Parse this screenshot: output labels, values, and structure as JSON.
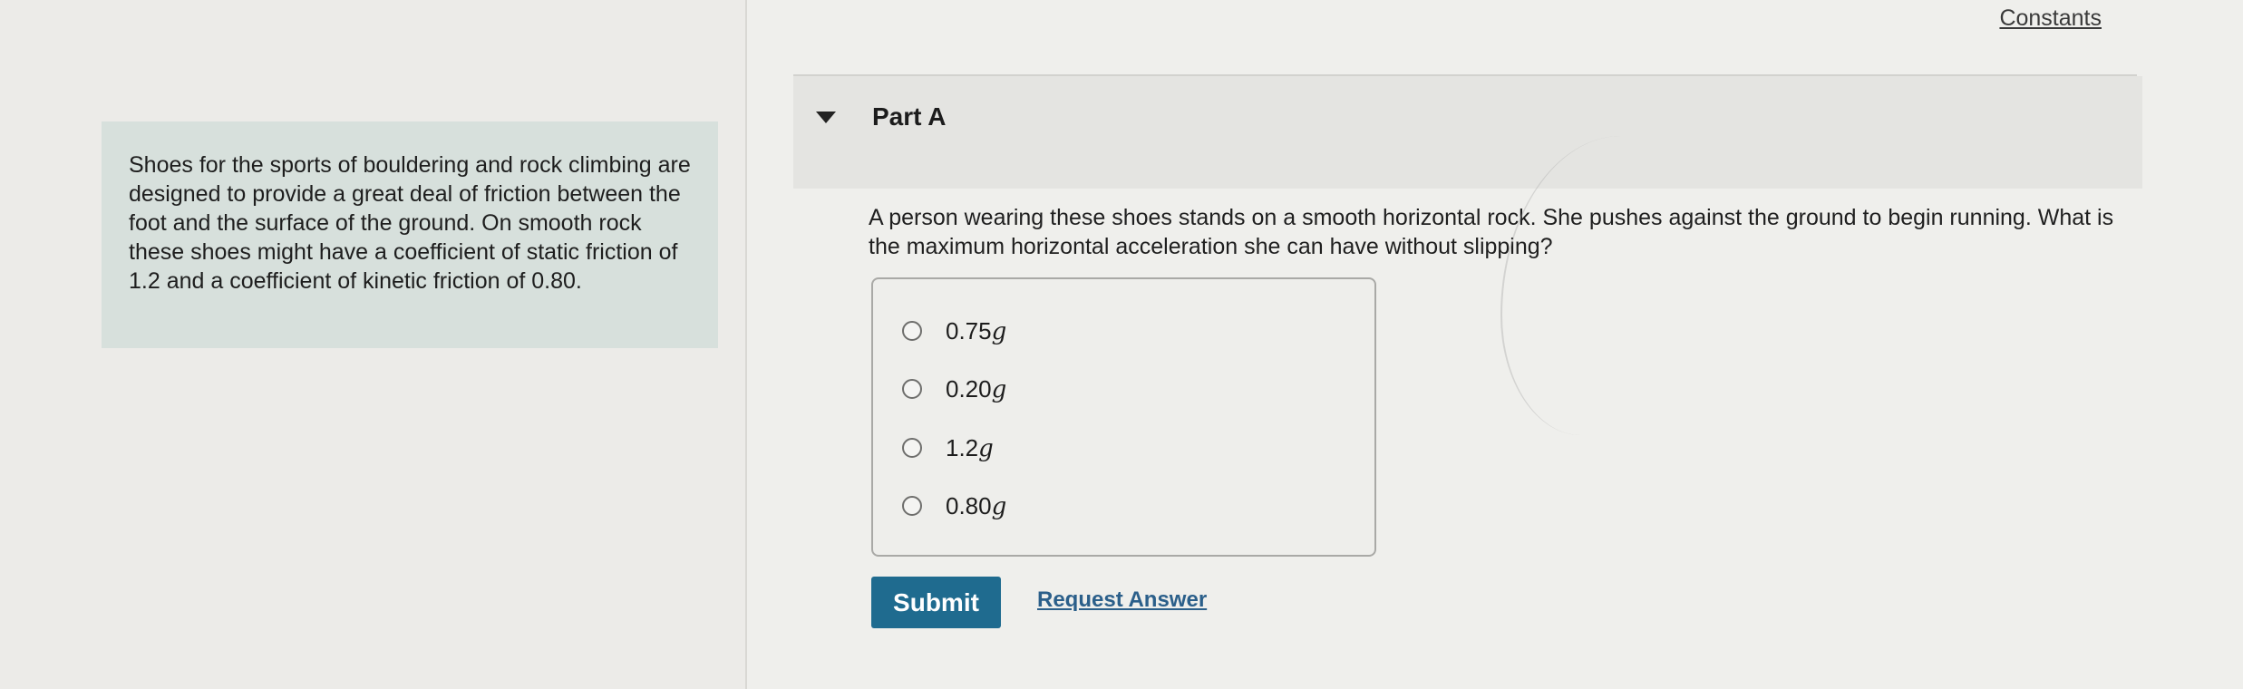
{
  "header": {
    "constants_link": "Constants"
  },
  "intro": {
    "text": "Shoes for the sports of bouldering and rock climbing are designed to provide a great deal of friction between the foot and the surface of the ground. On smooth rock these shoes might have a coefficient of static friction of 1.2 and a coefficient of kinetic friction of 0.80."
  },
  "part": {
    "title": "Part A",
    "question": "A person wearing these shoes stands on a smooth horizontal rock. She pushes against the ground to begin running. What is the maximum horizontal acceleration she can have without slipping?",
    "options": [
      {
        "value": "0.75",
        "unit": "g"
      },
      {
        "value": "0.20",
        "unit": "g"
      },
      {
        "value": "1.2",
        "unit": "g"
      },
      {
        "value": "0.80",
        "unit": "g"
      }
    ],
    "submit_label": "Submit",
    "request_answer_label": "Request Answer"
  }
}
